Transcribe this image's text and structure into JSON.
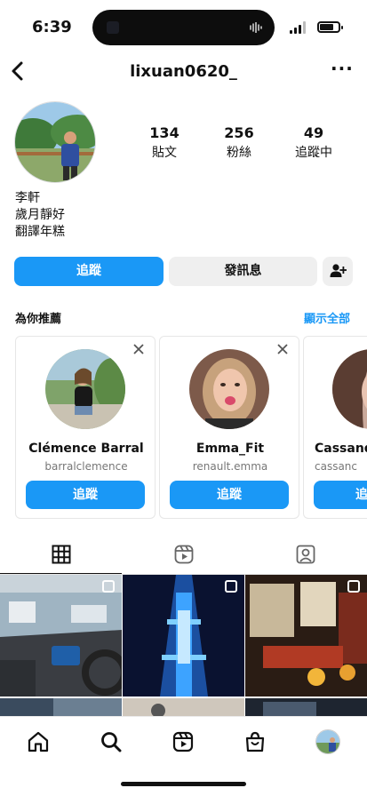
{
  "status_bar": {
    "time": "6:39"
  },
  "header": {
    "username": "lixuan0620_",
    "more_label": "···"
  },
  "profile": {
    "stats": [
      {
        "value": "134",
        "label": "貼文"
      },
      {
        "value": "256",
        "label": "粉絲"
      },
      {
        "value": "49",
        "label": "追蹤中"
      }
    ],
    "bio": [
      "李軒",
      "歲月靜好",
      "翻譯年糕"
    ]
  },
  "actions": {
    "follow_label": "追蹤",
    "message_label": "發訊息"
  },
  "suggestions": {
    "title": "為你推薦",
    "see_all": "顯示全部",
    "cards": [
      {
        "name": "Clémence Barral",
        "handle": "barralclemence",
        "button": "追蹤"
      },
      {
        "name": "Emma_Fit",
        "handle": "renault.emma",
        "button": "追蹤"
      },
      {
        "name": "Cassand",
        "handle": "cassanc",
        "button": "追"
      }
    ]
  },
  "tabs": [
    "grid-icon",
    "reels-icon",
    "tagged-icon"
  ],
  "bottom_nav": [
    "home-icon",
    "search-icon",
    "reels-icon",
    "shop-icon",
    "profile-avatar"
  ],
  "colors": {
    "accent": "#1a98f6",
    "secondary_button": "#efefef"
  }
}
